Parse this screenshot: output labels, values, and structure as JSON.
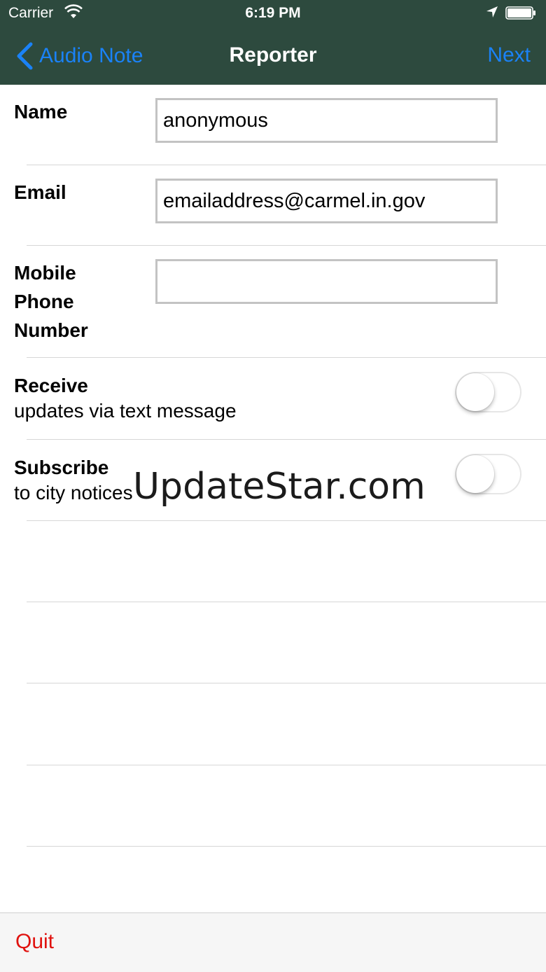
{
  "status_bar": {
    "carrier": "Carrier",
    "time": "6:19 PM"
  },
  "nav": {
    "back_label": "Audio Note",
    "title": "Reporter",
    "next_label": "Next"
  },
  "form": {
    "name": {
      "label": "Name",
      "value": "anonymous"
    },
    "email": {
      "label": "Email",
      "value": "emailaddress@carmel.in.gov"
    },
    "mobile": {
      "label_line1": "Mobile",
      "label_line2": "Phone",
      "label_line3": "Number",
      "value": ""
    },
    "receive": {
      "label": "Receive",
      "sublabel": "updates via text message",
      "on": false
    },
    "subscribe": {
      "label": "Subscribe",
      "sublabel": "to city notices",
      "on": false
    }
  },
  "watermark": "UpdateStar.com",
  "bottom": {
    "quit_label": "Quit"
  },
  "colors": {
    "nav_bg": "#2d4a3e",
    "link_blue": "#1a82f7",
    "quit_red": "#e0120f"
  }
}
